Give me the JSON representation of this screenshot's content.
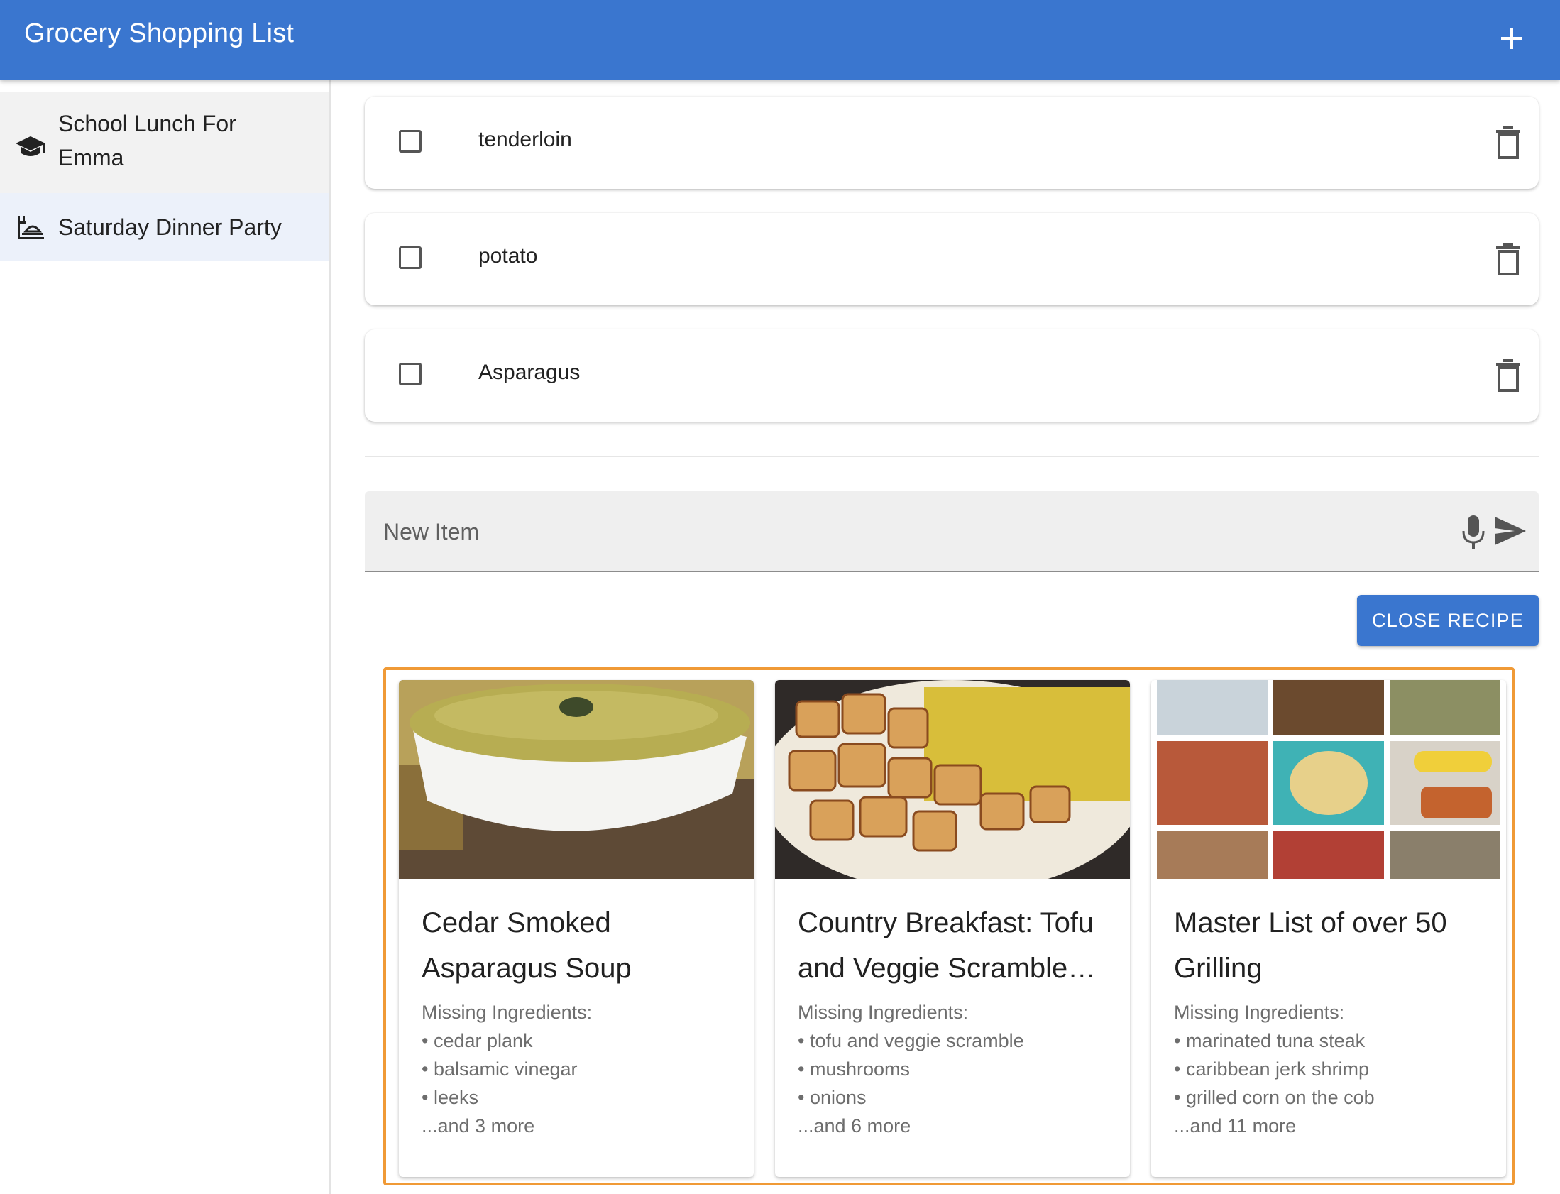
{
  "app": {
    "title": "Grocery Shopping List",
    "add_icon": "plus-icon"
  },
  "sidebar": {
    "items": [
      {
        "label": "School Lunch For Emma",
        "icon": "graduation-cap-icon"
      },
      {
        "label": "Saturday Dinner Party",
        "icon": "dinner-table-icon"
      }
    ]
  },
  "list": {
    "items": [
      {
        "name": "tenderloin",
        "checked": false
      },
      {
        "name": "potato",
        "checked": false
      },
      {
        "name": "Asparagus",
        "checked": false
      }
    ]
  },
  "new_item": {
    "placeholder": "New Item",
    "mic_icon": "microphone-icon",
    "send_icon": "send-icon"
  },
  "close_recipe": {
    "label": "CLOSE RECIPE"
  },
  "recipes": [
    {
      "title": "Cedar Smoked Asparagus Soup",
      "missing_label": "Missing Ingredients:",
      "ingredients": [
        "• cedar plank",
        "• balsamic vinegar",
        "• leeks"
      ],
      "more": "...and 3 more"
    },
    {
      "title": "Country Breakfast: Tofu and Veggie Scramble…",
      "missing_label": "Missing Ingredients:",
      "ingredients": [
        "• tofu and veggie scramble",
        "• mushrooms",
        "• onions"
      ],
      "more": "...and 6 more"
    },
    {
      "title": "Master List of over 50 Grilling",
      "missing_label": "Missing Ingredients:",
      "ingredients": [
        "• marinated tuna steak",
        "• caribbean jerk shrimp",
        "• grilled corn on the cob"
      ],
      "more": "...and 11 more"
    }
  ],
  "colors": {
    "primary": "#3a76cf",
    "highlight": "#f09a36",
    "sidebar_selected": "#ecf1fa"
  }
}
